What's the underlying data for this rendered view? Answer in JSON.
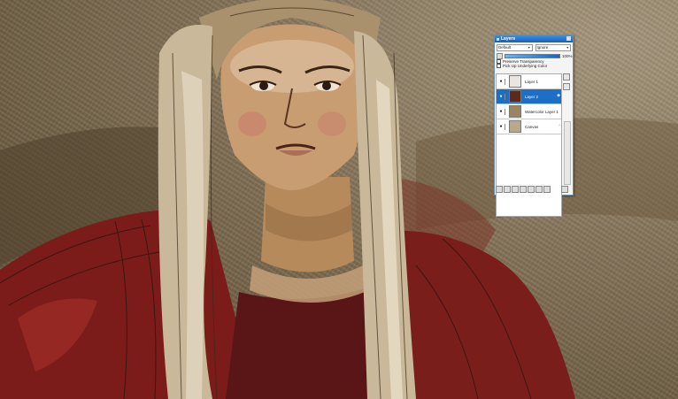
{
  "panel": {
    "title": "Layers",
    "composite_method": "Default",
    "composite_depth": "Ignore",
    "opacity": "100%",
    "preserve_transparency": "Preserve Transparency",
    "pick_up_underlying_color": "Pick Up Underlying Color",
    "layers": [
      {
        "name": "Layer 1",
        "selected": false
      },
      {
        "name": "Layer 2",
        "selected": true
      },
      {
        "name": "Watercolor Layer 1",
        "selected": false
      },
      {
        "name": "Canvas",
        "selected": false
      }
    ]
  }
}
